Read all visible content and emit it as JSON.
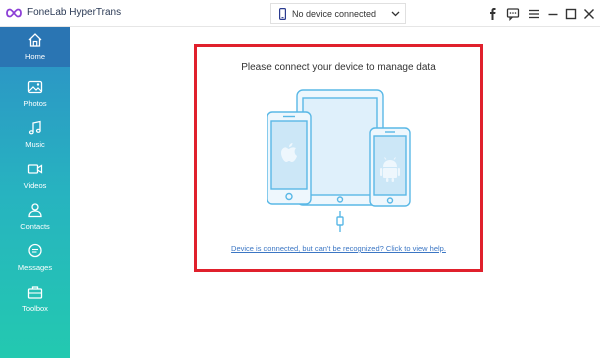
{
  "app": {
    "title": "FoneLab HyperTrans",
    "logo_icon": "infinity-logo-icon",
    "accent_color": "#8c3fd6"
  },
  "device_selector": {
    "text": "No device connected",
    "icon": "phone-icon"
  },
  "window_controls": {
    "icons": [
      "facebook-icon",
      "chat-icon",
      "menu-icon",
      "minimize-icon",
      "maximize-icon",
      "close-icon"
    ]
  },
  "sidebar": {
    "items": [
      {
        "label": "Home",
        "icon": "home-icon",
        "active": true
      },
      {
        "label": "Photos",
        "icon": "photos-icon",
        "active": false
      },
      {
        "label": "Music",
        "icon": "music-icon",
        "active": false
      },
      {
        "label": "Videos",
        "icon": "videos-icon",
        "active": false
      },
      {
        "label": "Contacts",
        "icon": "contacts-icon",
        "active": false
      },
      {
        "label": "Messages",
        "icon": "messages-icon",
        "active": false
      },
      {
        "label": "Toolbox",
        "icon": "toolbox-icon",
        "active": false
      }
    ],
    "gradient": [
      "#2d8fc7",
      "#23c9b0"
    ]
  },
  "main": {
    "title": "Please connect your device to manage data",
    "help_link": "Device is connected, but can't be recognized? Click to view help.",
    "highlight_color": "#e0202c",
    "illustration_color": "#5ab8e6"
  }
}
